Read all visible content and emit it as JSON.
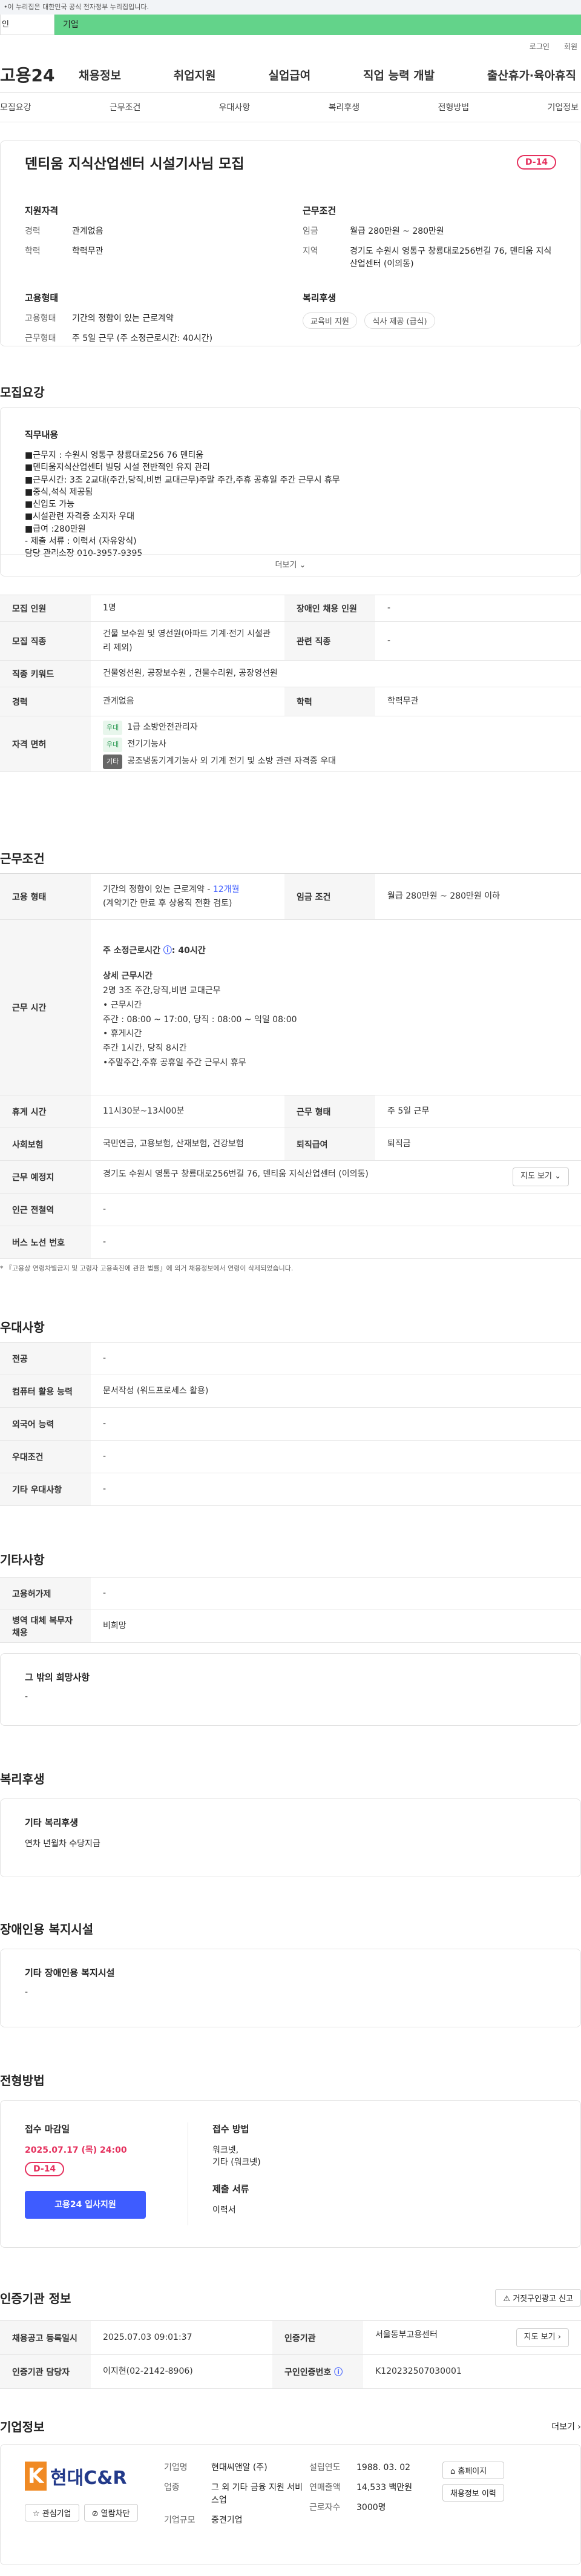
{
  "gov_notice": "•이 누리집은 대한민국 공식 전자정부 누리집입니다.",
  "site_tabs": [
    "인",
    "기업"
  ],
  "util_links": [
    "로그인",
    "회원"
  ],
  "logo": {
    "text": "고용24"
  },
  "gnb": [
    "채용정보",
    "취업지원",
    "실업급여",
    "직업 능력 개발",
    "출산휴가·육아휴직"
  ],
  "subnav": [
    "모집요강",
    "근무조건",
    "우대사항",
    "복리후생",
    "전형방법",
    "기업정보"
  ],
  "job": {
    "title": "덴티움 지식산업센터 시설기사님 모집",
    "dday": "D-14"
  },
  "summary": {
    "qual_h": "지원자격",
    "qual": [
      {
        "k": "경력",
        "v": "관계없음"
      },
      {
        "k": "학력",
        "v": "학력무관"
      }
    ],
    "emp_h": "고용형태",
    "emp": [
      {
        "k": "고용형태",
        "v": "기간의 정함이 있는 근로계약"
      },
      {
        "k": "근무형태",
        "v": "주 5일 근무 (주 소정근로시간: 40시간)"
      }
    ],
    "cond_h": "근무조건",
    "cond": [
      {
        "k": "임금",
        "v": "월급 280만원 ~ 280만원"
      },
      {
        "k": "지역",
        "v": "경기도 수원시 영통구 창룡대로256번길 76, 덴티움 지식산업센터 (이의동)"
      }
    ],
    "welfare_h": "복리후생",
    "welfare_chips": [
      "교육비 지원",
      "식사 제공 (급식)"
    ]
  },
  "recruit": {
    "section": "모집요강",
    "duty_h": "직무내용",
    "duty_lines": [
      "■근무지 : 수원시 영통구 창룡대로256 76 덴티움",
      "■덴티움지식산업센터 빌딩 시설 전반적인 유지 관리",
      "■근무시간: 3조 2교대(주간,당직,비번 교대근무)주말 주간,주휴 공휴일 주간 근무시 휴무",
      "■중식,석식 제공됨",
      "■신입도 가능",
      "■시설관련 자격증 소지자 우대",
      "■급여 :280만원",
      " - 제출 서류 : 이력서 (자유양식)",
      " 담당 관리소장 010-3957-9395"
    ],
    "more_label": "더보기 ⌄",
    "rows": {
      "headcount_k": "모집 인원",
      "headcount_v": "1명",
      "disabled_k": "장애인 채용 인원",
      "disabled_v": "-",
      "job_k": "모집 직종",
      "job_v": "건물 보수원 및 영선원(아파트 기계·전기 시설관리 제외)",
      "related_k": "관련 직종",
      "related_v": "-",
      "keyword_k": "직종 키워드",
      "keyword_v": "건물영선원, 공장보수원 , 건물수리원, 공장영선원",
      "career_k": "경력",
      "career_v": "관계없음",
      "edu_k": "학력",
      "edu_v": "학력무관",
      "license_k": "자격 면허",
      "licenses": [
        {
          "tag": "우대",
          "text": "1급 소방안전관리자"
        },
        {
          "tag": "우대",
          "text": "전기기능사"
        },
        {
          "tag": "기타",
          "text": "공조냉동기계기능사 외 기계 전기 및 소방 관련 자격증 우대"
        }
      ]
    }
  },
  "conditions": {
    "section": "근무조건",
    "emp_k": "고용 형태",
    "emp_v1": "기간의 정함이 있는 근로계약 - ",
    "emp_v1_link": "12개월",
    "emp_v2": "(계약기간 만료 후 상용직 전환 검토)",
    "wage_k": "임금 조건",
    "wage_v": "월급 280만원 ~ 280만원 이하",
    "hours_k": "근무 시간",
    "hours_main": "주 소정근로시간 ",
    "hours_main_val": ": 40시간",
    "hours_detail_h": "상세 근무시간",
    "hours_detail": [
      "2명 3조 주간,당직,비번 교대근무",
      "• 근무시간",
      "주간 : 08:00 ~ 17:00, 당직 : 08:00 ~ 익일 08:00",
      "• 휴게시간",
      "주간 1시간, 당직 8시간",
      "•주말주간,주휴 공휴일 주간 근무시 휴무"
    ],
    "break_k": "휴게 시간",
    "break_v": "11시30분~13시00분",
    "workform_k": "근무 형태",
    "workform_v": "주 5일 근무",
    "insurance_k": "사회보험",
    "insurance_v": "국민연금, 고용보험, 산재보험, 건강보험",
    "severance_k": "퇴직급여",
    "severance_v": "퇴직금",
    "place_k": "근무 예정지",
    "place_v": "경기도 수원시 영통구 창룡대로256번길 76, 덴티움 지식산업센터 (이의동)",
    "map_label": "지도 보기 ⌄",
    "subway_k": "인근 전철역",
    "subway_v": "-",
    "bus_k": "버스 노선 번호",
    "bus_v": "-",
    "note": "* 『고용상 연령차별금지 및 고령자 고용촉진에 관한 법률』에 의거 채용정보에서 연령이 삭제되었습니다."
  },
  "preferred": {
    "section": "우대사항",
    "rows": [
      {
        "k": "전공",
        "v": "-"
      },
      {
        "k": "컴퓨터 활용 능력",
        "v": "문서작성 (워드프로세스 활용)"
      },
      {
        "k": "외국어 능력",
        "v": "-"
      },
      {
        "k": "우대조건",
        "v": "-"
      },
      {
        "k": "기타 우대사항",
        "v": "-"
      }
    ]
  },
  "others": {
    "section": "기타사항",
    "rows": [
      {
        "k": "고용허가제",
        "v": "-"
      },
      {
        "k": "병역 대체 복무자 채용",
        "v": "비희망"
      }
    ],
    "other_h": "그 밖의 희망사항",
    "other_v": "-"
  },
  "welfare": {
    "section": "복리후생",
    "box_h": "기타 복리후생",
    "box_v": "연차 년월차 수당지급"
  },
  "disabled": {
    "section": "장애인용 복지시설",
    "box_h": "기타 장애인용 복지시설",
    "box_v": "-"
  },
  "screening": {
    "section": "전형방법",
    "deadline_h": "접수 마감일",
    "deadline_v": "2025.07.17 (목) 24:00",
    "dday": "D-14",
    "apply_btn": "고용24 입사지원",
    "method_h": "접수 방법",
    "method_v1": "워크넷,",
    "method_v2": "기타 (워크넷)",
    "docs_h": "제출 서류",
    "docs_v": "이력서"
  },
  "agency": {
    "section": "인증기관 정보",
    "report_btn": "거짓구인광고 신고",
    "reg_k": "채용공고 등록일시",
    "reg_v": "2025.07.03 09:01:37",
    "org_k": "인증기관",
    "org_v": "서울동부고용센터",
    "map_btn": "지도 보기",
    "staff_k": "인증기관 담당자",
    "staff_v": "이지현(02-2142-8906)",
    "num_k": "구인인증번호",
    "num_v": "K120232507030001"
  },
  "company": {
    "section": "기업정보",
    "more": "더보기",
    "logo_text": "현대C&R",
    "logo_k": "K",
    "interest_btn": "관심기업",
    "block_btn": "열람차단",
    "name_k": "기업명",
    "name_v": "현대씨앤알 (주)",
    "industry_k": "업종",
    "industry_v": "그 외 기타 금융 지원 서비스업",
    "size_k": "기업규모",
    "size_v": "중견기업",
    "founded_k": "설립연도",
    "founded_v": "1988. 03. 02",
    "revenue_k": "연매출액",
    "revenue_v": "14,533 백만원",
    "emp_k": "근로자수",
    "emp_v": "3000명",
    "home_btn": "홈페이지",
    "recruit_btn": "채용정보 이력"
  },
  "colors": {
    "accent": "#3e5cff",
    "dday": "#e5305d",
    "green": "#63d38a"
  }
}
